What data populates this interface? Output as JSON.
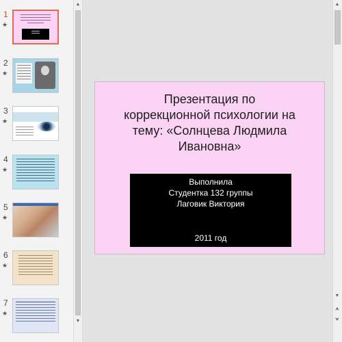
{
  "thumbnails": [
    {
      "number": "1",
      "star": "★",
      "selected": true
    },
    {
      "number": "2",
      "star": "★"
    },
    {
      "number": "3",
      "star": "★"
    },
    {
      "number": "4",
      "star": "★"
    },
    {
      "number": "5",
      "star": "★"
    },
    {
      "number": "6",
      "star": "★"
    },
    {
      "number": "7",
      "star": "★"
    }
  ],
  "slide": {
    "title_lines": [
      "Презентация по",
      "коррекционной психологии на",
      "тему: «Солнцева Людмила",
      "Ивановна»"
    ],
    "subtitle_lines": [
      "Выполнила",
      "Студентка 132 группы",
      "Лаговик Виктория"
    ],
    "year": "2011 год",
    "background_color": "#fbd3f5",
    "box_color": "#000000"
  },
  "icons": {
    "scroll_up": "▲",
    "scroll_down": "▼",
    "prev_slide": "⮝",
    "next_slide": "⮟"
  },
  "colors": {
    "selected_border": "#e36a4f",
    "workspace": "#e2e2e2"
  }
}
